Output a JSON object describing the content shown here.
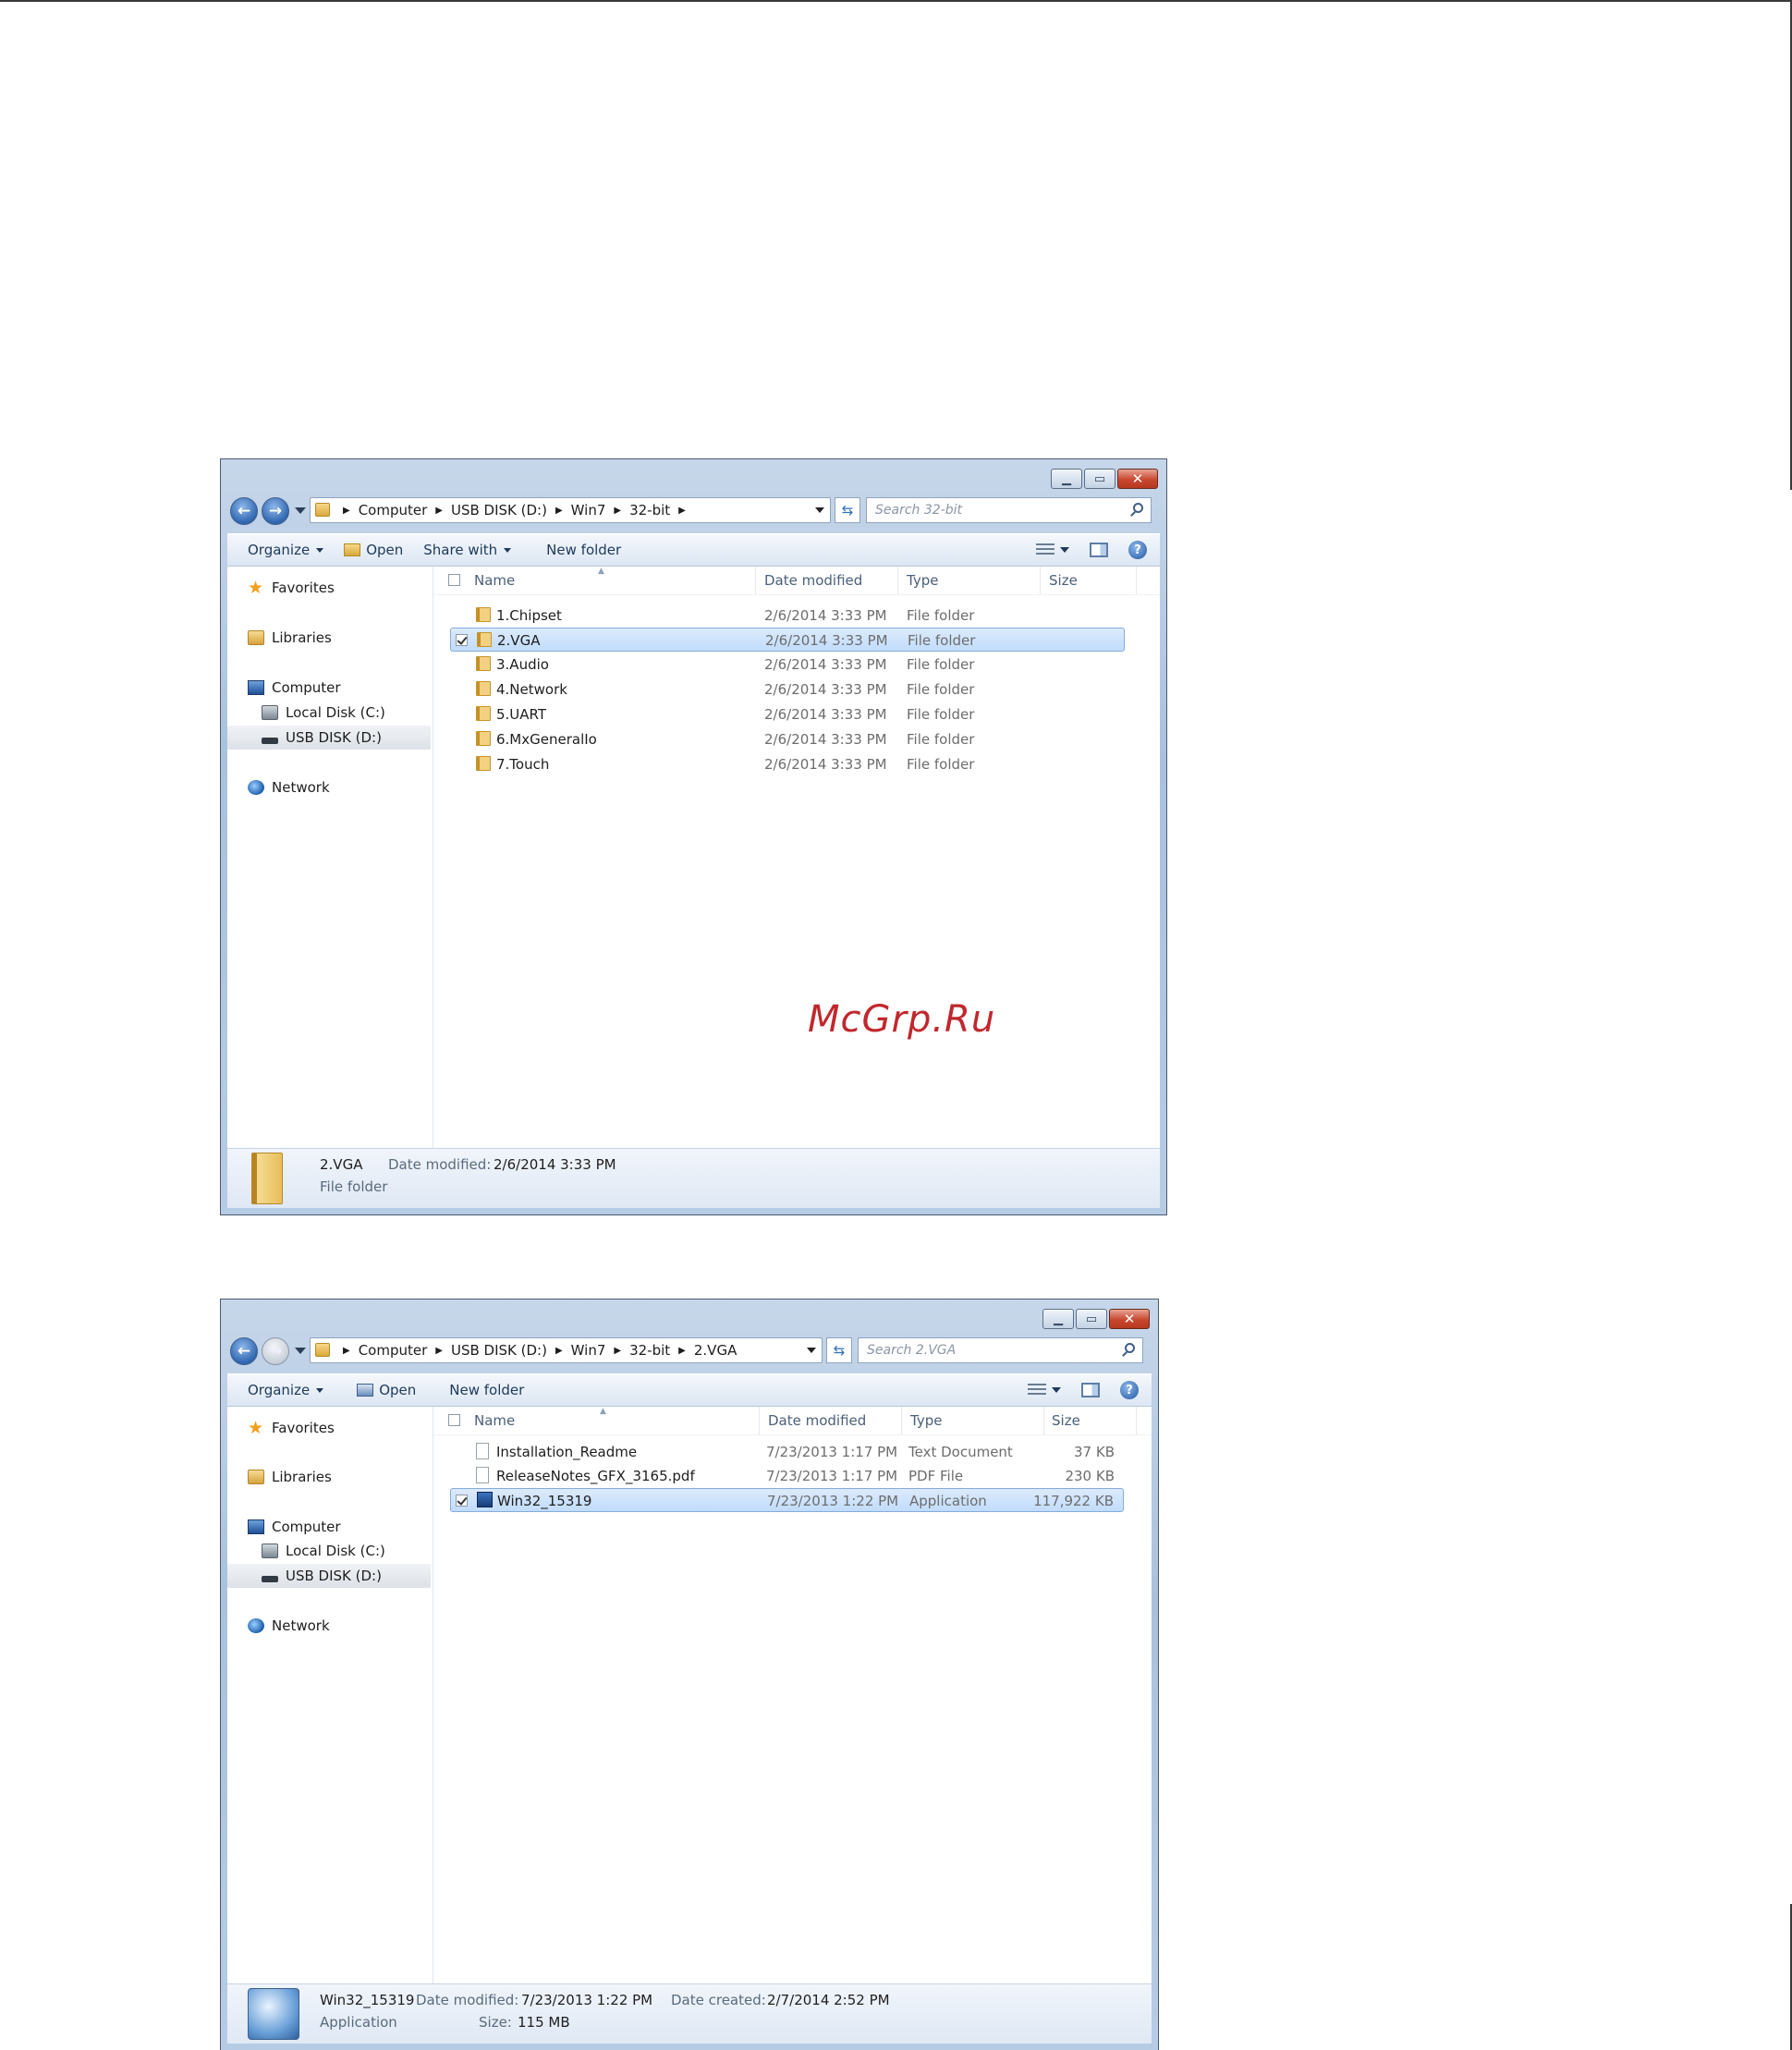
{
  "watermark": "McGrp.Ru",
  "window1": {
    "breadcrumbs": [
      "Computer",
      "USB DISK (D:)",
      "Win7",
      "32-bit"
    ],
    "search_placeholder": "Search 32-bit",
    "toolbar": {
      "organize": "Organize",
      "open": "Open",
      "share_with": "Share with",
      "new_folder": "New folder"
    },
    "nav": {
      "favorites": "Favorites",
      "libraries": "Libraries",
      "computer": "Computer",
      "local_disk": "Local Disk (C:)",
      "usb_disk": "USB DISK (D:)",
      "network": "Network"
    },
    "columns": {
      "name": "Name",
      "date_modified": "Date modified",
      "type": "Type",
      "size": "Size"
    },
    "rows": [
      {
        "name": "1.Chipset",
        "date": "2/6/2014 3:33 PM",
        "type": "File folder",
        "size": "",
        "selected": false
      },
      {
        "name": "2.VGA",
        "date": "2/6/2014 3:33 PM",
        "type": "File folder",
        "size": "",
        "selected": true
      },
      {
        "name": "3.Audio",
        "date": "2/6/2014 3:33 PM",
        "type": "File folder",
        "size": "",
        "selected": false
      },
      {
        "name": "4.Network",
        "date": "2/6/2014 3:33 PM",
        "type": "File folder",
        "size": "",
        "selected": false
      },
      {
        "name": "5.UART",
        "date": "2/6/2014 3:33 PM",
        "type": "File folder",
        "size": "",
        "selected": false
      },
      {
        "name": "6.MxGeneralIo",
        "date": "2/6/2014 3:33 PM",
        "type": "File folder",
        "size": "",
        "selected": false
      },
      {
        "name": "7.Touch",
        "date": "2/6/2014 3:33 PM",
        "type": "File folder",
        "size": "",
        "selected": false
      }
    ],
    "details": {
      "name": "2.VGA",
      "date_label": "Date modified:",
      "date_value": "2/6/2014 3:33 PM",
      "type": "File folder"
    }
  },
  "window2": {
    "breadcrumbs": [
      "Computer",
      "USB DISK (D:)",
      "Win7",
      "32-bit",
      "2.VGA"
    ],
    "search_placeholder": "Search 2.VGA",
    "toolbar": {
      "organize": "Organize",
      "open": "Open",
      "new_folder": "New folder"
    },
    "nav": {
      "favorites": "Favorites",
      "libraries": "Libraries",
      "computer": "Computer",
      "local_disk": "Local Disk (C:)",
      "usb_disk": "USB DISK (D:)",
      "network": "Network"
    },
    "columns": {
      "name": "Name",
      "date_modified": "Date modified",
      "type": "Type",
      "size": "Size"
    },
    "rows": [
      {
        "name": "Installation_Readme",
        "date": "7/23/2013 1:17 PM",
        "type": "Text Document",
        "size": "37 KB",
        "selected": false,
        "icon": "document-icon"
      },
      {
        "name": "ReleaseNotes_GFX_3165.pdf",
        "date": "7/23/2013 1:17 PM",
        "type": "PDF File",
        "size": "230 KB",
        "selected": false,
        "icon": "document-icon"
      },
      {
        "name": "Win32_15319",
        "date": "7/23/2013 1:22 PM",
        "type": "Application",
        "size": "117,922 KB",
        "selected": true,
        "icon": "application-icon"
      }
    ],
    "details": {
      "name": "Win32_15319",
      "date_label": "Date modified:",
      "date_value": "7/23/2013 1:22 PM",
      "created_label": "Date created:",
      "created_value": "2/7/2014 2:52 PM",
      "type": "Application",
      "size_label": "Size:",
      "size_value": "115 MB"
    }
  }
}
